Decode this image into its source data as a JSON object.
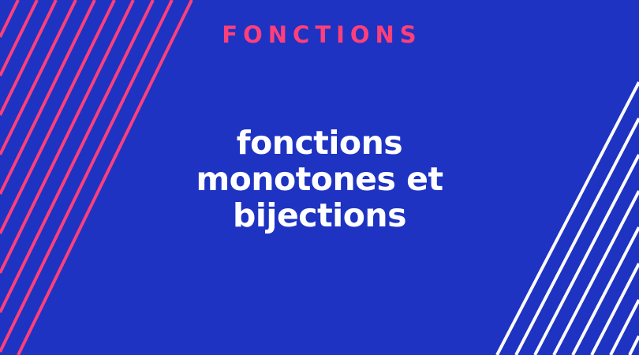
{
  "header": {
    "category": "FONCTIONS"
  },
  "main": {
    "title_lines": [
      "fonctions",
      "monotones et",
      "bijections"
    ]
  },
  "colors": {
    "background": "#1e33c2",
    "accent": "#ff3f7a",
    "text": "#ffffff"
  }
}
